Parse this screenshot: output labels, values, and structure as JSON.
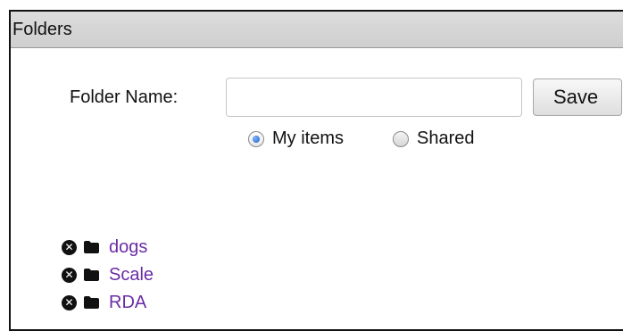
{
  "panel": {
    "title": "Folders"
  },
  "form": {
    "name_label": "Folder Name:",
    "name_value": "",
    "name_placeholder": "",
    "save_label": "Save",
    "scope_options": [
      {
        "label": "My items",
        "selected": true
      },
      {
        "label": "Shared",
        "selected": false
      }
    ]
  },
  "folders": [
    {
      "name": "dogs"
    },
    {
      "name": "Scale"
    },
    {
      "name": "RDA"
    }
  ],
  "icons": {
    "delete": "close-circle-icon",
    "folder": "folder-icon"
  },
  "colors": {
    "link": "#6b2ba7",
    "header_bg": "#d4d4d4",
    "radio_selected": "#2a6fd6"
  }
}
